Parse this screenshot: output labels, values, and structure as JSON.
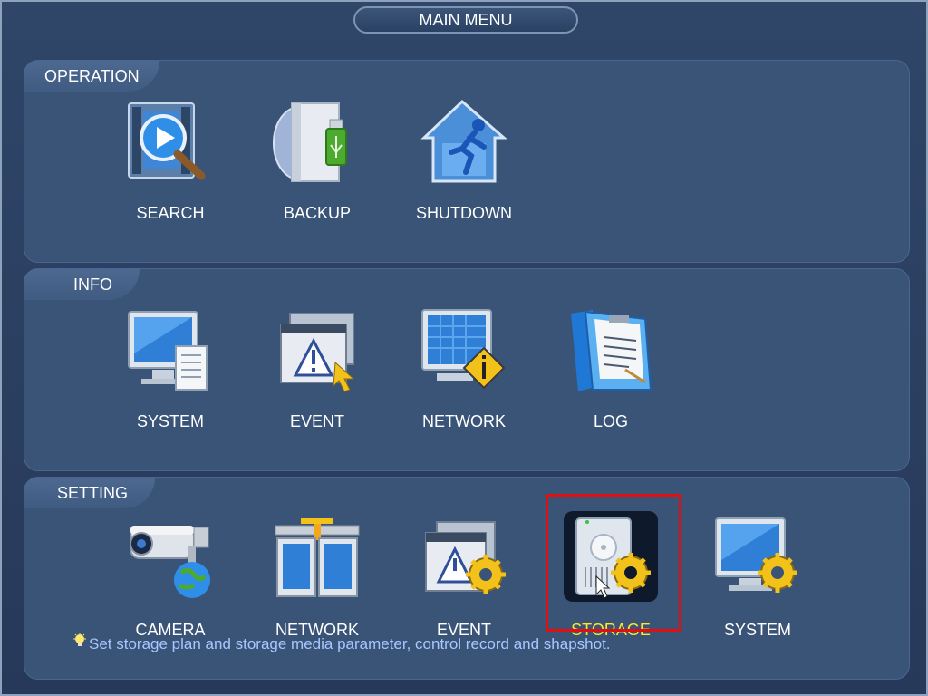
{
  "window": {
    "title": "MAIN MENU"
  },
  "sections": {
    "operation": {
      "label": "OPERATION",
      "items": [
        "SEARCH",
        "BACKUP",
        "SHUTDOWN"
      ]
    },
    "info": {
      "label": "INFO",
      "items": [
        "SYSTEM",
        "EVENT",
        "NETWORK",
        "LOG"
      ]
    },
    "setting": {
      "label": "SETTING",
      "items": [
        "CAMERA",
        "NETWORK",
        "EVENT",
        "STORAGE",
        "SYSTEM"
      ],
      "selected": "STORAGE"
    }
  },
  "hint": {
    "text": "Set storage plan and storage media parameter, control record and shapshot."
  },
  "colors": {
    "background": "#2a3f5e",
    "panel": "#3a5478",
    "selected_label": "#ffe52e",
    "selection_border": "#e01010",
    "hint_text": "#a9c6ff"
  },
  "icons": [
    "search-icon",
    "backup-icon",
    "shutdown-icon",
    "system-info-icon",
    "event-info-icon",
    "network-info-icon",
    "log-icon",
    "camera-icon",
    "network-setting-icon",
    "event-setting-icon",
    "storage-icon",
    "system-setting-icon"
  ]
}
